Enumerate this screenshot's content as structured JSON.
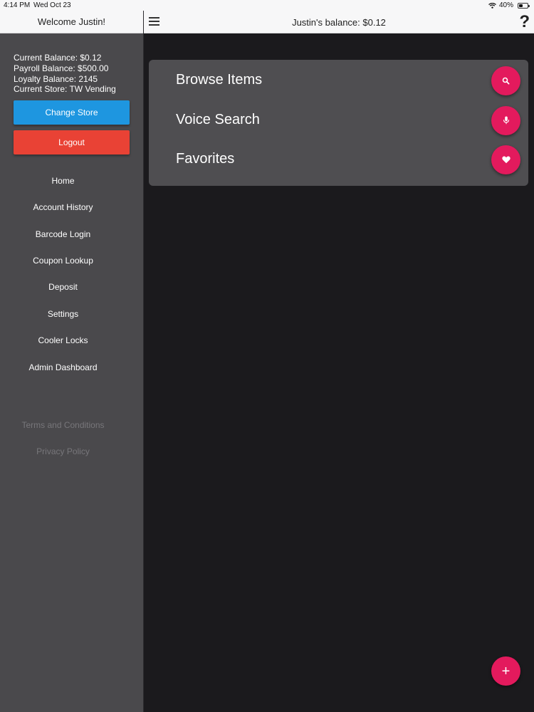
{
  "status_bar": {
    "time": "4:14 PM",
    "date": "Wed Oct 23",
    "battery": "40%",
    "battery_level": 0.4,
    "wifi_icon": "wifi-icon",
    "battery_icon": "battery-icon"
  },
  "sidebar": {
    "header": "Welcome Justin!",
    "balances": [
      "Current Balance: $0.12",
      "Payroll Balance: $500.00",
      "Loyalty Balance: 2145",
      "Current Store: TW Vending"
    ],
    "change_store_label": "Change Store",
    "logout_label": "Logout",
    "menu": [
      "Home",
      "Account History",
      "Barcode Login",
      "Coupon Lookup",
      "Deposit",
      "Settings",
      "Cooler Locks",
      "Admin Dashboard"
    ],
    "legal": [
      "Terms and Conditions",
      "Privacy Policy"
    ]
  },
  "topbar": {
    "title": "Justin's balance: $0.12",
    "menu_icon": "hamburger-menu-icon",
    "help": "?"
  },
  "card": {
    "items": [
      {
        "label": "Browse Items",
        "icon": "search-icon"
      },
      {
        "label": "Voice Search",
        "icon": "microphone-icon"
      },
      {
        "label": "Favorites",
        "icon": "heart-icon"
      }
    ]
  },
  "fab": {
    "label": "+",
    "icon": "plus-icon"
  },
  "colors": {
    "accent": "#e31a5d",
    "change_store": "#1e96e0",
    "logout": "#e94235",
    "sidebar_bg": "#4a494c",
    "main_bg": "#1b1a1d",
    "card_bg": "#4f4e51"
  }
}
